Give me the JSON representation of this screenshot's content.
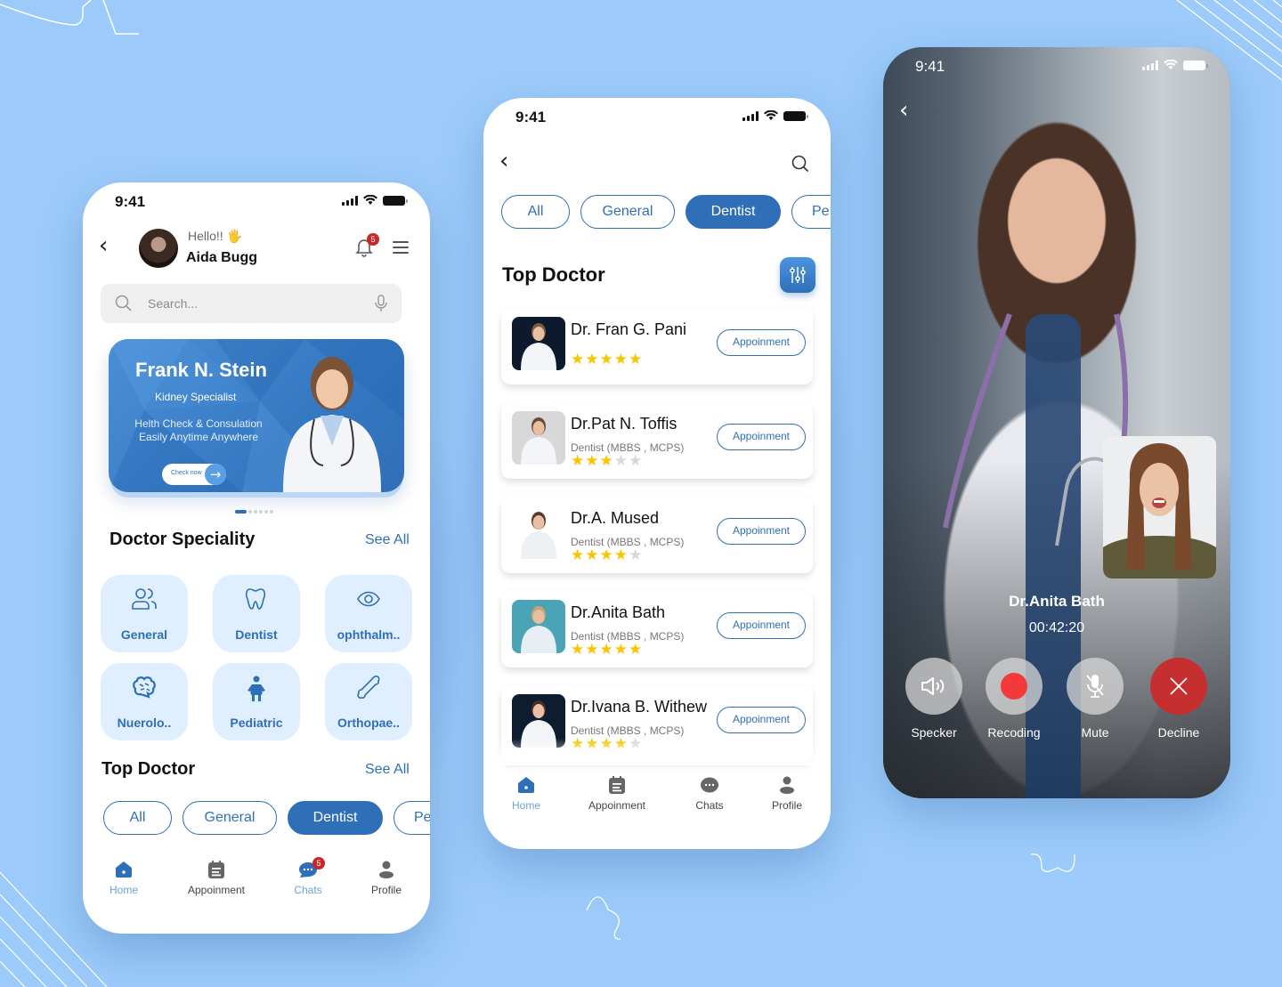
{
  "colors": {
    "background": "#9ccbfb",
    "primary": "#2f6fb8",
    "speciality_tile": "#e0efff",
    "star": "#f7c600",
    "badge": "#c62828",
    "decline": "#c62f2f",
    "record": "#f33a3a"
  },
  "home_screen": {
    "status_time": "9:41",
    "greeting": "Hello!! 🖐",
    "user_name": "Aida Bugg",
    "notification_count": "5",
    "search_placeholder": "Search...",
    "banner": {
      "doctor_name": "Frank N. Stein",
      "specialty": "Kidney Specialist",
      "description_line1": "Helth Check  & Consulation",
      "description_line2": "Easily Anytime Anywhere",
      "cta": "Check now",
      "carousel_pages": 6,
      "carousel_active_index": 0
    },
    "speciality_section": {
      "title": "Doctor Speciality",
      "see_all": "See All",
      "items": [
        {
          "label": "General",
          "icon": "users-icon"
        },
        {
          "label": "Dentist",
          "icon": "tooth-icon"
        },
        {
          "label": "ophthalm..",
          "icon": "eye-icon"
        },
        {
          "label": "Nuerolo..",
          "icon": "brain-icon"
        },
        {
          "label": "Pediatric",
          "icon": "child-icon"
        },
        {
          "label": "Orthopae..",
          "icon": "bone-icon"
        }
      ]
    },
    "top_doctor_section": {
      "title": "Top Doctor",
      "see_all": "See All",
      "filters": [
        "All",
        "General",
        "Dentist",
        "Pe"
      ],
      "active_filter": "Dentist"
    },
    "tabbar": [
      {
        "label": "Home",
        "icon": "home-icon",
        "active": true
      },
      {
        "label": "Appoinment",
        "icon": "calendar-icon",
        "active": false
      },
      {
        "label": "Chats",
        "icon": "chat-icon",
        "active": true,
        "badge": "5"
      },
      {
        "label": "Profile",
        "icon": "user-icon",
        "active": false
      }
    ]
  },
  "doctor_list_screen": {
    "status_time": "9:41",
    "filters": [
      "All",
      "General",
      "Dentist",
      "Pe"
    ],
    "active_filter": "Dentist",
    "title": "Top Doctor",
    "doctors": [
      {
        "name": "Dr. Fran G. Pani",
        "qualification": "",
        "rating": 5,
        "button": "Appoinment"
      },
      {
        "name": "Dr.Pat N. Toffis",
        "qualification": "Dentist    (MBBS , MCPS)",
        "rating": 3,
        "button": "Appoinment"
      },
      {
        "name": "Dr.A. Mused",
        "qualification": "Dentist    (MBBS , MCPS)",
        "rating": 4,
        "button": "Appoinment"
      },
      {
        "name": "Dr.Anita Bath",
        "qualification": "Dentist    (MBBS , MCPS)",
        "rating": 5,
        "button": "Appoinment"
      },
      {
        "name": "Dr.Ivana B. Withew",
        "qualification": "Dentist    (MBBS , MCPS)",
        "rating": 4,
        "button": "Appoinment"
      }
    ],
    "tabbar": [
      {
        "label": "Home",
        "icon": "home-icon",
        "active": true
      },
      {
        "label": "Appoinment",
        "icon": "calendar-icon",
        "active": false
      },
      {
        "label": "Chats",
        "icon": "chat-icon",
        "active": false
      },
      {
        "label": "Profile",
        "icon": "user-icon",
        "active": false
      }
    ]
  },
  "video_call_screen": {
    "status_time": "9:41",
    "caller_name": "Dr.Anita Bath",
    "duration": "00:42:20",
    "controls": [
      {
        "label": "Specker",
        "icon": "speaker-icon"
      },
      {
        "label": "Recoding",
        "icon": "record-icon"
      },
      {
        "label": "Mute",
        "icon": "mic-off-icon"
      },
      {
        "label": "Decline",
        "icon": "close-icon"
      }
    ]
  }
}
